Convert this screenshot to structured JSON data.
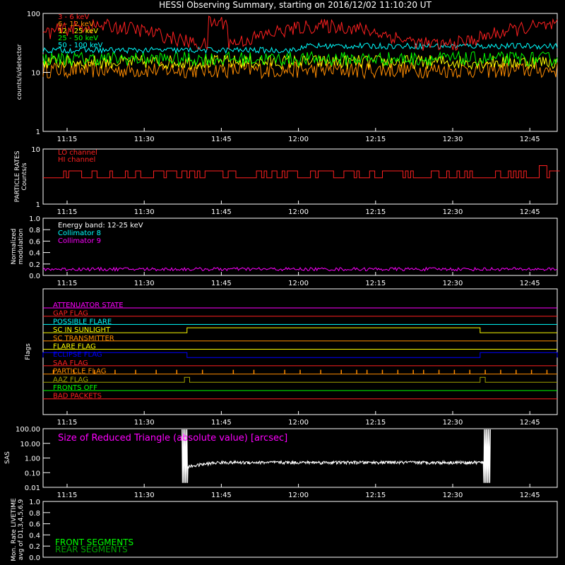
{
  "title": "HESSI Observing Summary, starting on 2016/12/02 11:10:20 UT",
  "time_ticks": [
    "11:15",
    "11:30",
    "11:45",
    "12:00",
    "12:15",
    "12:30",
    "12:45"
  ],
  "colors": {
    "red": "#ff2020",
    "orange": "#ff8c00",
    "yellow": "#ffff00",
    "green": "#00ff00",
    "cyan": "#00ffff",
    "magenta": "#ff00ff",
    "white": "#ffffff",
    "blue": "#0000ff",
    "olive": "#a0a000"
  },
  "chart_data": [
    {
      "type": "line",
      "id": "counts",
      "ylabel": "counts/s/detector",
      "yscale": "log",
      "ylim": [
        1,
        100
      ],
      "yticks": [
        "100",
        "10",
        "1"
      ],
      "xlim_minutes": [
        0,
        100
      ],
      "series": [
        {
          "name": "3 - 6 keV",
          "color": "#ff2020",
          "level": 45,
          "jitter": 0.12
        },
        {
          "name": "6 - 12 keV",
          "color": "#ff8c00",
          "level": 11,
          "jitter": 0.14
        },
        {
          "name": "12 - 25 keV",
          "color": "#ffff00",
          "level": 15,
          "jitter": 0.12
        },
        {
          "name": "25 - 50 keV",
          "color": "#00ff00",
          "level": 17,
          "jitter": 0.12
        },
        {
          "name": "50 - 100 keV",
          "color": "#00ffff",
          "level": 28,
          "jitter": 0.05
        }
      ],
      "legend_label_lines": [
        "3 - 6 keV",
        "6 - 12 keV",
        "12 - 25 keV",
        "25 - 50 keV",
        "50 - 100 keV"
      ]
    },
    {
      "type": "line",
      "id": "particle",
      "ylabel_lines": [
        "PARTICLE RATES",
        "Counts/s"
      ],
      "yscale": "log",
      "ylim": [
        1,
        10
      ],
      "yticks": [
        "10",
        "1"
      ],
      "legend": [
        "LO channel",
        "HI channel"
      ],
      "series": [
        {
          "name": "LO channel",
          "color": "#ff2020",
          "levels": [
            3,
            4
          ]
        }
      ]
    },
    {
      "type": "line",
      "id": "modulation",
      "ylabel_lines": [
        "Normalized",
        "modulation"
      ],
      "ylim": [
        0,
        1
      ],
      "yticks": [
        "1.0",
        "0.8",
        "0.6",
        "0.4",
        "0.2",
        "0.0"
      ],
      "legend": [
        "Energy band: 12-25 keV",
        "Collimator 8",
        "Collimator 9"
      ],
      "series": [
        {
          "name": "Collimator 9",
          "color": "#ff00ff",
          "level": 0.11
        }
      ]
    },
    {
      "type": "line",
      "id": "flags",
      "ylabel": "Flags",
      "flags": [
        {
          "name": "ATTENUATOR STATE",
          "color": "#ff00ff"
        },
        {
          "name": "GAP FLAG",
          "color": "#ff2020"
        },
        {
          "name": "POSSIBLE FLARE",
          "color": "#00ffff"
        },
        {
          "name": "SC IN SUNLIGHT",
          "color": "#ffff00",
          "steps": [
            [
              28,
              85
            ]
          ]
        },
        {
          "name": "SC TRANSMITTER",
          "color": "#ff8c00"
        },
        {
          "name": "FLARE FLAG",
          "color": "#ffff00"
        },
        {
          "name": "ECLIPSE FLAG",
          "color": "#0000ff",
          "steps": [
            [
              0,
              28
            ],
            [
              85,
              100
            ]
          ]
        },
        {
          "name": "SAA FLAG",
          "color": "#ff2020"
        },
        {
          "name": "PARTICLE FLAG",
          "color": "#ff8c00",
          "spikes": [
            2,
            6,
            10,
            14,
            18,
            22,
            26,
            31,
            37,
            41,
            47,
            50,
            54,
            58,
            61,
            63,
            66,
            69,
            72,
            74,
            77,
            80,
            83,
            86,
            89,
            92,
            95,
            98
          ]
        },
        {
          "name": "AAZ FLAG",
          "color": "#a0a000",
          "steps": [
            [
              27.5,
              28.5
            ],
            [
              85,
              86
            ]
          ]
        },
        {
          "name": "FRONTS OFF",
          "color": "#00ff00"
        },
        {
          "name": "BAD PACKETS",
          "color": "#ff2020"
        }
      ]
    },
    {
      "type": "line",
      "id": "sas",
      "ylabel": "SAS",
      "yscale": "log",
      "ylim": [
        0.01,
        100
      ],
      "yticks": [
        "100.00",
        "10.00",
        "1.00",
        "0.10",
        "0.01"
      ],
      "annotation": "Size of Reduced Triangle (absolute value) [arcsec]",
      "series": [
        {
          "name": "SAS",
          "color": "#ffffff",
          "level": 0.5
        }
      ]
    },
    {
      "type": "line",
      "id": "livetime",
      "ylabel_lines": [
        "Mon. Rate LIVETIME",
        "avg of D1,3,4,5,6,9"
      ],
      "ylim": [
        0,
        1
      ],
      "yticks": [
        "1.0",
        "0.8",
        "0.6",
        "0.4",
        "0.2",
        "0.0"
      ],
      "legend": [
        "FRONT SEGMENTS",
        "REAR SEGMENTS"
      ]
    }
  ]
}
